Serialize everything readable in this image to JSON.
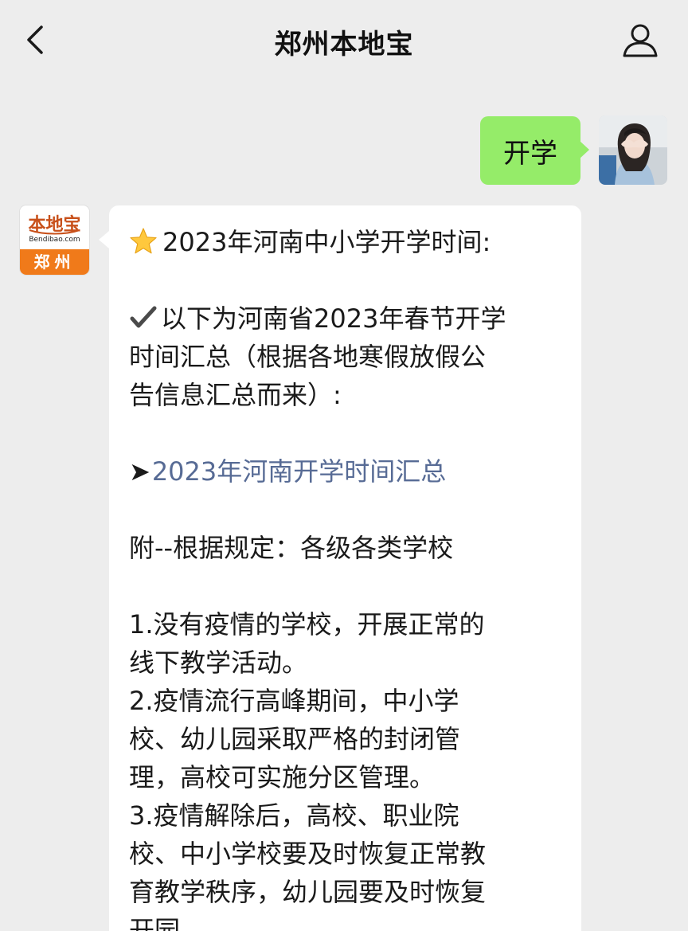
{
  "header": {
    "title": "郑州本地宝",
    "back_icon": "chevron-left-icon",
    "profile_icon": "person-icon"
  },
  "conversation": {
    "outgoing": {
      "text": "开学",
      "bubble_color": "#95ec69"
    },
    "sender_logo": {
      "brand": "本地宝",
      "url": "Bendibao.com",
      "city": "郑州",
      "accent_color": "#f07a1a"
    },
    "incoming": {
      "title": "2023年河南中小学开学时间:",
      "intro_line1": "以下为河南省2023年春节开学",
      "intro_line2": "时间汇总（根据各地寒假放假公",
      "intro_line3": "告信息汇总而来）:",
      "link_arrow": "➤",
      "link_text": "2023年河南开学时间汇总",
      "link_color": "#576b95",
      "note": "附--根据规定：各级各类学校",
      "item1_line1": "1.没有疫情的学校，开展正常的",
      "item1_line2": "线下教学活动。",
      "item2_line1": "2.疫情流行高峰期间，中小学",
      "item2_line2": "校、幼儿园采取严格的封闭管",
      "item2_line3": "理，高校可实施分区管理。",
      "item3_line1": "3.疫情解除后，高校、职业院",
      "item3_line2": "校、中小学校要及时恢复正常教",
      "item3_line3": "育教学秩序，幼儿园要及时恢复",
      "item3_line4": "开园。"
    }
  }
}
